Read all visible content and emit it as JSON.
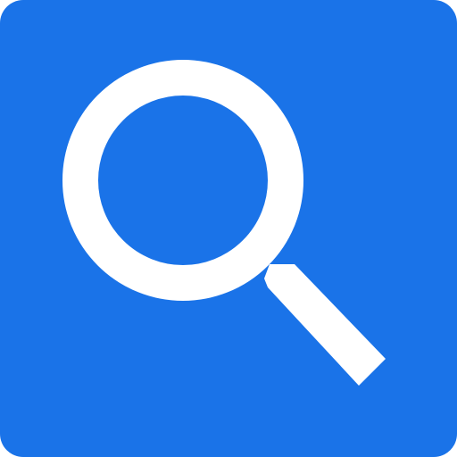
{
  "app_icon": {
    "icon": "search-icon",
    "background_color": "#1a73e8",
    "glyph_color": "#ffffff"
  }
}
